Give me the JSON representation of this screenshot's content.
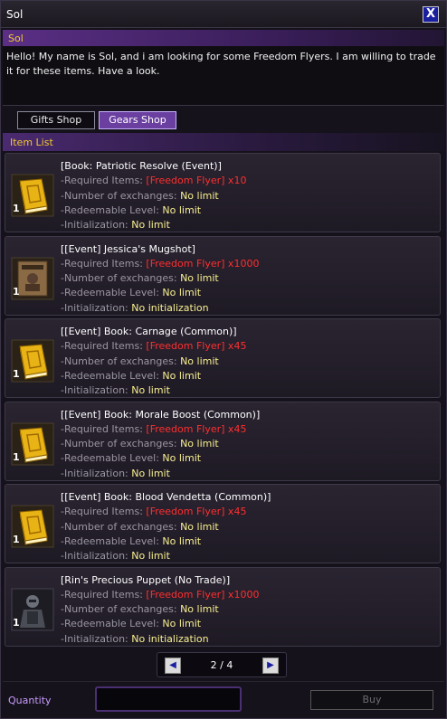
{
  "window": {
    "title": "Sol",
    "close_label": "X"
  },
  "npc": {
    "name": "Sol",
    "dialog": "Hello! My name is Sol, and i am looking for some Freedom Flyers. I am willing to trade it for these items. Have a look."
  },
  "tabs": [
    {
      "label": "Gifts Shop",
      "active": false
    },
    {
      "label": "Gears Shop",
      "active": true
    }
  ],
  "list_header": "Item List",
  "field_labels": {
    "required": "-Required Items:",
    "exchanges": "-Number of exchanges:",
    "level": "-Redeemable Level:",
    "init": "-Initialization:"
  },
  "items": [
    {
      "name": "[Book: Patriotic Resolve (Event)]",
      "qty": "1",
      "icon": "yellow-book-icon",
      "required": "[Freedom Flyer] x10",
      "exchanges": "No limit",
      "level": "No limit",
      "init": "No limit"
    },
    {
      "name": "[[Event] Jessica's Mugshot]",
      "qty": "1",
      "icon": "mugshot-poster-icon",
      "required": "[Freedom Flyer] x1000",
      "exchanges": "No limit",
      "level": "No limit",
      "init": "No initialization"
    },
    {
      "name": "[[Event] Book: Carnage (Common)]",
      "qty": "1",
      "icon": "yellow-book-icon",
      "required": "[Freedom Flyer] x45",
      "exchanges": "No limit",
      "level": "No limit",
      "init": "No limit"
    },
    {
      "name": "[[Event] Book: Morale Boost (Common)]",
      "qty": "1",
      "icon": "yellow-book-icon",
      "required": "[Freedom Flyer] x45",
      "exchanges": "No limit",
      "level": "No limit",
      "init": "No limit"
    },
    {
      "name": "[[Event] Book: Blood Vendetta (Common)]",
      "qty": "1",
      "icon": "yellow-book-icon",
      "required": "[Freedom Flyer] x45",
      "exchanges": "No limit",
      "level": "No limit",
      "init": "No limit"
    },
    {
      "name": "[Rin's Precious Puppet (No Trade)]",
      "qty": "1",
      "icon": "puppet-icon",
      "required": "[Freedom Flyer] x1000",
      "exchanges": "No limit",
      "level": "No limit",
      "init": "No initialization"
    }
  ],
  "pager": {
    "text": "2 / 4",
    "prev_icon": "arrow-left-icon",
    "next_icon": "arrow-right-icon"
  },
  "footer": {
    "quantity_label": "Quantity",
    "quantity_value": "",
    "buy_label": "Buy"
  },
  "colors": {
    "accent_purple": "#6a3fa0",
    "header_gold": "#f0c830",
    "required_red": "#ff2f2f",
    "value_yellow": "#f8f090",
    "label_gray": "#9a96a2"
  }
}
